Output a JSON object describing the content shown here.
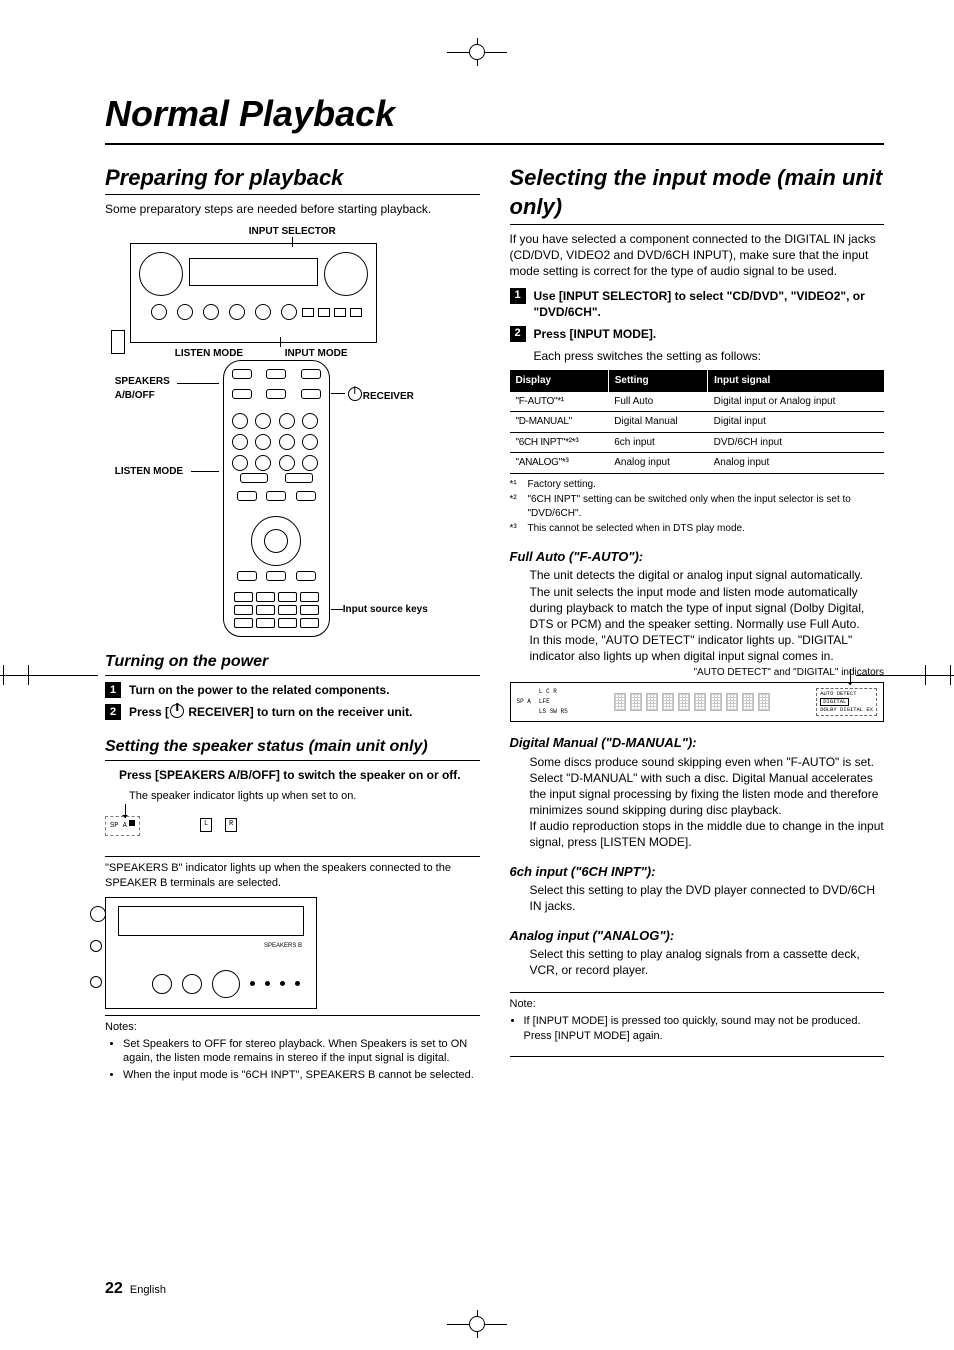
{
  "page": {
    "number": "22",
    "lang": "English"
  },
  "title": "Normal Playback",
  "left": {
    "h2": "Preparing for playback",
    "intro": "Some preparatory steps are needed before starting playback.",
    "diagram": {
      "input_selector": "INPUT SELECTOR",
      "listen_mode_top": "LISTEN MODE",
      "input_mode": "INPUT MODE",
      "speakers_aboff": "SPEAKERS\nA/B/OFF",
      "receiver": "RECEIVER",
      "listen_mode_side": "LISTEN MODE",
      "input_source_keys": "Input source keys"
    },
    "power": {
      "h3": "Turning on the power",
      "step1_pre": "Turn on the power to the related components.",
      "step2_pre": "Press [",
      "step2_post": " RECEIVER] to turn on the receiver unit."
    },
    "speaker": {
      "h3": "Setting the speaker status (main unit only)",
      "step_text": "Press [SPEAKERS A/B/OFF] to switch the speaker on or off.",
      "sub": "The speaker indicator lights up when set to on.",
      "ind": {
        "spa": "SP A",
        "l": "L",
        "r": "R",
        "spkb": "SPEAKERS B"
      },
      "after": "\"SPEAKERS B\" indicator lights up when the speakers connected to the SPEAKER B terminals are selected.",
      "notes_title": "Notes:",
      "notes": [
        "Set Speakers to OFF for stereo playback. When Speakers is set to ON again, the listen mode remains in stereo if the input signal is digital.",
        "When the input mode is \"6CH INPT\", SPEAKERS B cannot be selected."
      ]
    }
  },
  "right": {
    "h2": "Selecting the input mode (main unit only)",
    "intro": "If you have selected a component connected to the DIGITAL IN jacks (CD/DVD, VIDEO2 and DVD/6CH INPUT), make sure that the input mode setting is correct for the type of audio signal to be used.",
    "step1": "Use [INPUT SELECTOR] to select \"CD/DVD\", \"VIDEO2\", or \"DVD/6CH\".",
    "step2": "Press [INPUT MODE].",
    "step2_sub": "Each press switches the setting as follows:",
    "table": {
      "headers": [
        "Display",
        "Setting",
        "Input signal"
      ],
      "rows": [
        [
          "\"F-AUTO\"*¹",
          "Full Auto",
          "Digital input or Analog input"
        ],
        [
          "\"D-MANUAL\"",
          "Digital Manual",
          "Digital input"
        ],
        [
          "\"6CH INPT\"*²*³",
          "6ch input",
          "DVD/6CH input"
        ],
        [
          "\"ANALOG\"*³",
          "Analog input",
          "Analog input"
        ]
      ]
    },
    "footnotes": [
      {
        "mark": "*¹",
        "text": "Factory setting."
      },
      {
        "mark": "*²",
        "text": "\"6CH INPT\" setting can be switched only when the input selector is set to \"DVD/6CH\"."
      },
      {
        "mark": "*³",
        "text": "This cannot be selected when in DTS play mode."
      }
    ],
    "fauto": {
      "h4": "Full Auto (\"F-AUTO\"):",
      "body": "The unit detects the digital or analog input signal automatically. The unit selects the input mode and listen mode automatically during playback to match the type of input signal (Dolby Digital, DTS or PCM) and the speaker setting. Normally use Full Auto.\nIn this mode, \"AUTO DETECT\" indicator lights up. \"DIGITAL\" indicator also lights up when digital input signal comes in.",
      "caption": "\"AUTO DETECT\" and \"DIGITAL\" indicators",
      "lcd": {
        "spa": "SP A",
        "lcr": "L C R",
        "lfe": "LFE",
        "lsrs": "LS SW RS",
        "auto": "AUTO DETECT",
        "digital": "DIGITAL",
        "dolby": "DOLBY DIGITAL EX"
      }
    },
    "dmanual": {
      "h4": "Digital Manual (\"D-MANUAL\"):",
      "body": "Some discs produce sound skipping even when \"F-AUTO\" is set. Select \"D-MANUAL\" with such a disc. Digital Manual accelerates the input signal processing by fixing the listen mode and therefore minimizes sound skipping during disc playback.\nIf audio reproduction stops in the middle due to change in the input signal, press [LISTEN MODE]."
    },
    "sixch": {
      "h4": "6ch input (\"6CH INPT\"):",
      "body": "Select this setting to play the DVD player connected to DVD/6CH IN jacks."
    },
    "analog": {
      "h4": "Analog input (\"ANALOG\"):",
      "body": "Select this setting to play analog signals from a cassette deck, VCR, or record player."
    },
    "note": {
      "title": "Note:",
      "body": "If [INPUT MODE] is pressed too quickly, sound may not be produced. Press [INPUT MODE] again."
    }
  }
}
